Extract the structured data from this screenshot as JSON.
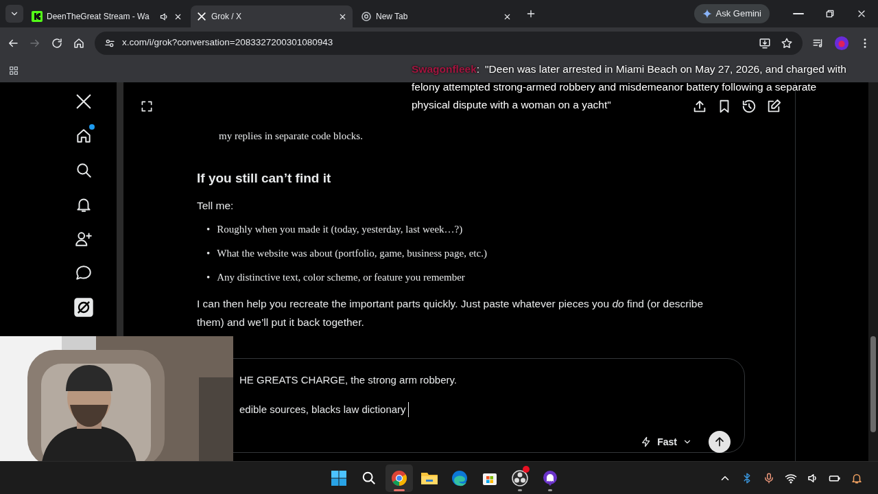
{
  "browser": {
    "tabs": [
      {
        "title": "DeenTheGreat Stream - Wa",
        "selected": false,
        "audio": true,
        "kind": "kick"
      },
      {
        "title": "Grok / X",
        "selected": true,
        "audio": false,
        "kind": "x"
      },
      {
        "title": "New Tab",
        "selected": false,
        "audio": false,
        "kind": "chrome"
      }
    ],
    "gemini_button": "Ask Gemini",
    "url": "x.com/i/grok?conversation=2083327200301080943"
  },
  "chat_overlay": {
    "username": "Swagonfleek",
    "separator": ":",
    "color": "#a3153f",
    "message_lines": [
      "\"Deen was later arrested in Miami Beach on May 27, 2026, and charged with",
      "felony attempted strong-armed robbery and misdemeanor battery following a separate",
      "physical dispute with a woman on a yacht\""
    ]
  },
  "sidebar": {
    "items": [
      {
        "kind": "logo",
        "selected": false,
        "badge": false
      },
      {
        "kind": "home",
        "selected": false,
        "badge": true
      },
      {
        "kind": "search",
        "selected": false,
        "badge": false
      },
      {
        "kind": "notifications",
        "selected": false,
        "badge": false
      },
      {
        "kind": "follow",
        "selected": false,
        "badge": false
      },
      {
        "kind": "messages",
        "selected": false,
        "badge": false
      },
      {
        "kind": "grok",
        "selected": true,
        "badge": false
      }
    ]
  },
  "conversation": {
    "continued_line": "my replies in separate code blocks.",
    "heading": "If you still can’t find it",
    "intro": "Tell me:",
    "bullet_marker": "•",
    "bullets": [
      "Roughly when you made it (today, yesterday, last week…?)",
      "What the website was about (portfolio, game, business page, etc.)",
      "Any distinctive text, color scheme, or feature you remember"
    ],
    "closing": "I can then help you recreate the important parts quickly. Just paste whatever pieces you *do* find (or describe them) and we’ll put it back together."
  },
  "composer": {
    "lines": [
      "HE GREATS CHARGE, the strong arm robbery.",
      "edible sources, blacks law dictionary"
    ],
    "mode": "Fast"
  },
  "taskbar": {
    "apps": [
      {
        "kind": "start",
        "active": false,
        "running": false,
        "badge": false
      },
      {
        "kind": "search",
        "active": false,
        "running": false,
        "badge": false
      },
      {
        "kind": "chrome",
        "active": true,
        "running": true,
        "badge": false
      },
      {
        "kind": "explorer",
        "active": false,
        "running": false,
        "badge": false
      },
      {
        "kind": "edge",
        "active": false,
        "running": false,
        "badge": false
      },
      {
        "kind": "store",
        "active": false,
        "running": false,
        "badge": false
      },
      {
        "kind": "obs",
        "active": false,
        "running": true,
        "badge": true
      },
      {
        "kind": "ghost",
        "active": false,
        "running": true,
        "badge": false
      }
    ]
  }
}
